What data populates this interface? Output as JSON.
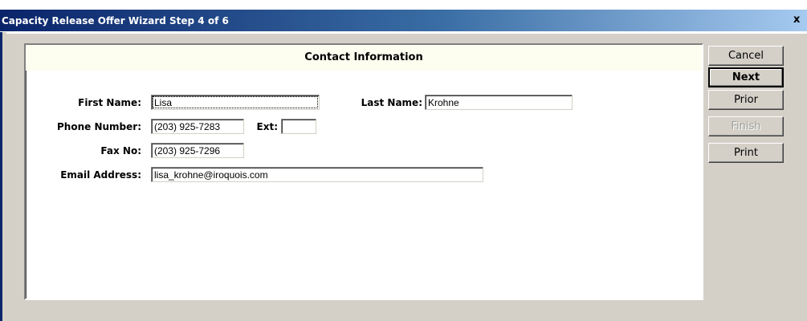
{
  "window": {
    "title": "Capacity Release Offer Wizard Step 4 of 6",
    "close_label": "x"
  },
  "panel": {
    "title": "Contact Information"
  },
  "form": {
    "first_name": {
      "label": "First Name:",
      "value": "Lisa"
    },
    "last_name": {
      "label": "Last Name:",
      "value": "Krohne"
    },
    "phone": {
      "label": "Phone Number:",
      "value": "(203) 925-7283"
    },
    "ext": {
      "label": "Ext:",
      "value": ""
    },
    "fax": {
      "label": "Fax No:",
      "value": "(203) 925-7296"
    },
    "email": {
      "label": "Email Address:",
      "value": "lisa_krohne@iroquois.com"
    }
  },
  "buttons": {
    "cancel": "Cancel",
    "next": "Next",
    "prior": "Prior",
    "finish": "Finish",
    "print": "Print"
  }
}
